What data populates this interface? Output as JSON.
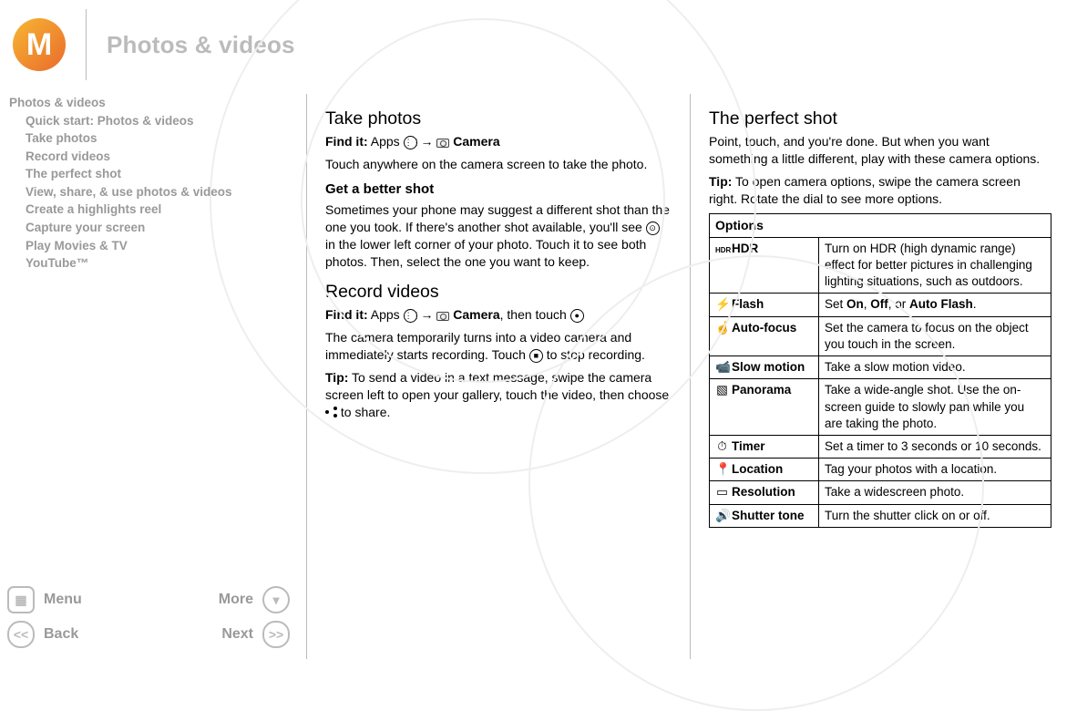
{
  "header": {
    "title": "Photos & videos",
    "logo_letter": "M"
  },
  "sidebar": {
    "head": "Photos & videos",
    "items": [
      "Quick start: Photos & videos",
      "Take photos",
      "Record videos",
      "The perfect shot",
      "View, share, & use photos & videos",
      "Create a highlights reel",
      "Capture your screen",
      "Play Movies & TV",
      "YouTube™"
    ]
  },
  "navbar": {
    "menu": "Menu",
    "more": "More",
    "back": "Back",
    "next": "Next"
  },
  "col1": {
    "h_take": "Take photos",
    "findit": "Find it:",
    "apps": " Apps ",
    "arrow": " → ",
    "camera": " Camera",
    "take_body": "Touch anywhere on the camera screen to take the photo.",
    "h_better": "Get a better shot",
    "better_body_a": "Sometimes your phone may suggest a different shot than the one you took. If there's another shot available, you'll see ",
    "better_body_b": " in the lower left corner of your photo. Touch it to see both photos. Then, select the one you want to keep.",
    "h_record": "Record videos",
    "record_then": ", then touch ",
    "record_body_a": "The camera temporarily turns into a video camera and immediately starts recording. Touch ",
    "record_body_b": " to stop recording.",
    "tip": "Tip:",
    "tip_body_a": " To send a video in a text message, swipe the camera screen left to open your gallery, touch the video, then choose ",
    "tip_body_b": " to share."
  },
  "col2": {
    "h_perfect": "The perfect shot",
    "perfect_body": "Point, touch, and you're done. But when you want something a little different, play with these camera options.",
    "tip": "Tip:",
    "tip_body": " To open camera options, swipe the camera screen right. Rotate the dial to see more options.",
    "table_header": "Options",
    "rows": [
      {
        "icon": "HDR",
        "name": "HDR",
        "desc": "Turn on HDR (high dynamic range) effect for better pictures in challenging lighting situations, such as outdoors."
      },
      {
        "icon": "⚡",
        "name": "Flash",
        "desc_pre": "Set ",
        "desc_b1": "On",
        "desc_mid1": ", ",
        "desc_b2": "Off",
        "desc_mid2": ", or ",
        "desc_b3": "Auto Flash",
        "desc_post": "."
      },
      {
        "icon": "☝",
        "name": "Auto-focus",
        "desc": "Set the camera to focus on the object you touch in the screen."
      },
      {
        "icon": "📹",
        "name": "Slow motion",
        "desc": "Take a slow motion video."
      },
      {
        "icon": "▧",
        "name": "Panorama",
        "desc": "Take a wide-angle shot. Use the on-screen guide to slowly pan while you are taking the photo."
      },
      {
        "icon": "⏱",
        "name": "Timer",
        "desc": "Set a timer to 3 seconds or 10 seconds."
      },
      {
        "icon": "📍",
        "name": "Location",
        "desc": "Tag your photos with a location."
      },
      {
        "icon": "▭",
        "name": "Resolution",
        "desc": "Take a widescreen photo."
      },
      {
        "icon": "🔊",
        "name": "Shutter tone",
        "desc": "Turn the shutter click on or off."
      }
    ]
  }
}
